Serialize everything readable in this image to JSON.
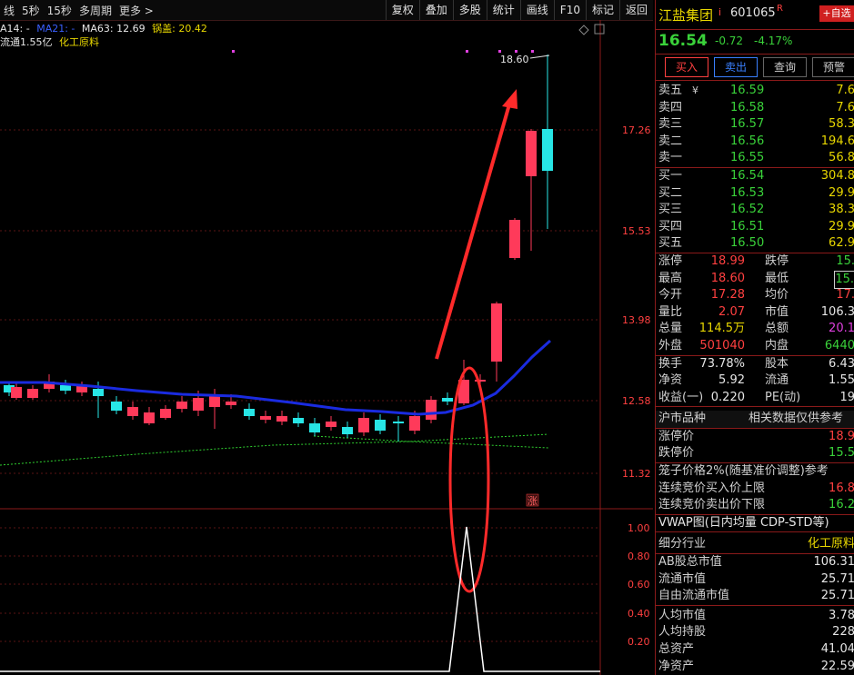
{
  "toolbar": {
    "left": [
      "线",
      "5秒",
      "15秒",
      "多周期",
      "更多 >"
    ],
    "right": [
      "复权",
      "叠加",
      "多股",
      "统计",
      "画线",
      "F10",
      "标记",
      "返回"
    ]
  },
  "info": {
    "ma14": "A14: -",
    "ma21": "MA21: -",
    "ma63": "MA63: 12.69",
    "guogai_label": "锅盖:",
    "guogai_val": "20.42",
    "float": "流通1.55亿",
    "industry": "化工原料"
  },
  "axis": {
    "ticks": [
      "17.26",
      "15.53",
      "13.98",
      "12.58",
      "11.32"
    ],
    "sub_ticks": [
      "1.00",
      "0.80",
      "0.60",
      "0.40",
      "0.20"
    ]
  },
  "high_label": "18.60",
  "limit_badge": "涨",
  "stock": {
    "name": "江盐集团",
    "mark": "i",
    "code": "601065",
    "r": "R",
    "fav": "+自选",
    "price": "16.54",
    "chg": "-0.72",
    "pct": "-4.17%"
  },
  "buttons": [
    "买入",
    "卖出",
    "查询",
    "预警"
  ],
  "sell": [
    {
      "l": "卖五",
      "p": "16.59",
      "v": "7.6"
    },
    {
      "l": "卖四",
      "p": "16.58",
      "v": "7.6"
    },
    {
      "l": "卖三",
      "p": "16.57",
      "v": "58.3"
    },
    {
      "l": "卖二",
      "p": "16.56",
      "v": "194.6"
    },
    {
      "l": "卖一",
      "p": "16.55",
      "v": "56.8"
    }
  ],
  "buy": [
    {
      "l": "买一",
      "p": "16.54",
      "v": "304.8"
    },
    {
      "l": "买二",
      "p": "16.53",
      "v": "29.9"
    },
    {
      "l": "买三",
      "p": "16.52",
      "v": "38.3"
    },
    {
      "l": "买四",
      "p": "16.51",
      "v": "29.9"
    },
    {
      "l": "买五",
      "p": "16.50",
      "v": "62.9"
    }
  ],
  "stats": [
    {
      "a": "涨停",
      "av": "18.99",
      "b": "跌停",
      "bv": "15."
    },
    {
      "a": "最高",
      "av": "18.60",
      "b": "最低",
      "bv": "15."
    },
    {
      "a": "今开",
      "av": "17.28",
      "b": "均价",
      "bv": "17."
    },
    {
      "a": "量比",
      "av": "2.07",
      "b": "市值",
      "bv": "106.3"
    },
    {
      "a": "总量",
      "av": "114.5万",
      "b": "总额",
      "bv": "20.1"
    },
    {
      "a": "外盘",
      "av": "501040",
      "b": "内盘",
      "bv": "6440"
    }
  ],
  "stats2": [
    {
      "a": "换手",
      "av": "73.78%",
      "b": "股本",
      "bv": "6.43"
    },
    {
      "a": "净资",
      "av": "5.92",
      "b": "流通",
      "bv": "1.55"
    },
    {
      "a": "收益(一)",
      "av": "0.220",
      "b": "PE(动)",
      "bv": "19"
    }
  ],
  "market": {
    "left": "沪市品种",
    "right": "相关数据仅供参考"
  },
  "limits": [
    {
      "l": "涨停价",
      "v": "18.9"
    },
    {
      "l": "跌停价",
      "v": "15.5"
    }
  ],
  "cage": "笼子价格2%(随基准价调整)参考",
  "cage_rows": [
    {
      "l": "连续竞价买入价上限",
      "v": "16.8"
    },
    {
      "l": "连续竞价卖出价下限",
      "v": "16.2"
    }
  ],
  "vwap": "VWAP图(日内均量 CDP-STD等)",
  "industry_row": {
    "l": "细分行业",
    "v": "化工原料"
  },
  "caps": [
    {
      "l": "AB股总市值",
      "v": "106.31"
    },
    {
      "l": "流通市值",
      "v": "25.71"
    },
    {
      "l": "自由流通市值",
      "v": "25.71"
    }
  ],
  "per": [
    {
      "l": "人均市值",
      "v": "3.78"
    },
    {
      "l": "人均持股",
      "v": "228"
    },
    {
      "l": "总资产",
      "v": "41.04"
    },
    {
      "l": "净资产",
      "v": "22.59"
    }
  ],
  "colors": {
    "up": "#ff3a5a",
    "down": "#27e6e6",
    "ma": "#1a2be0",
    "arrow": "#ff2a2a"
  }
}
